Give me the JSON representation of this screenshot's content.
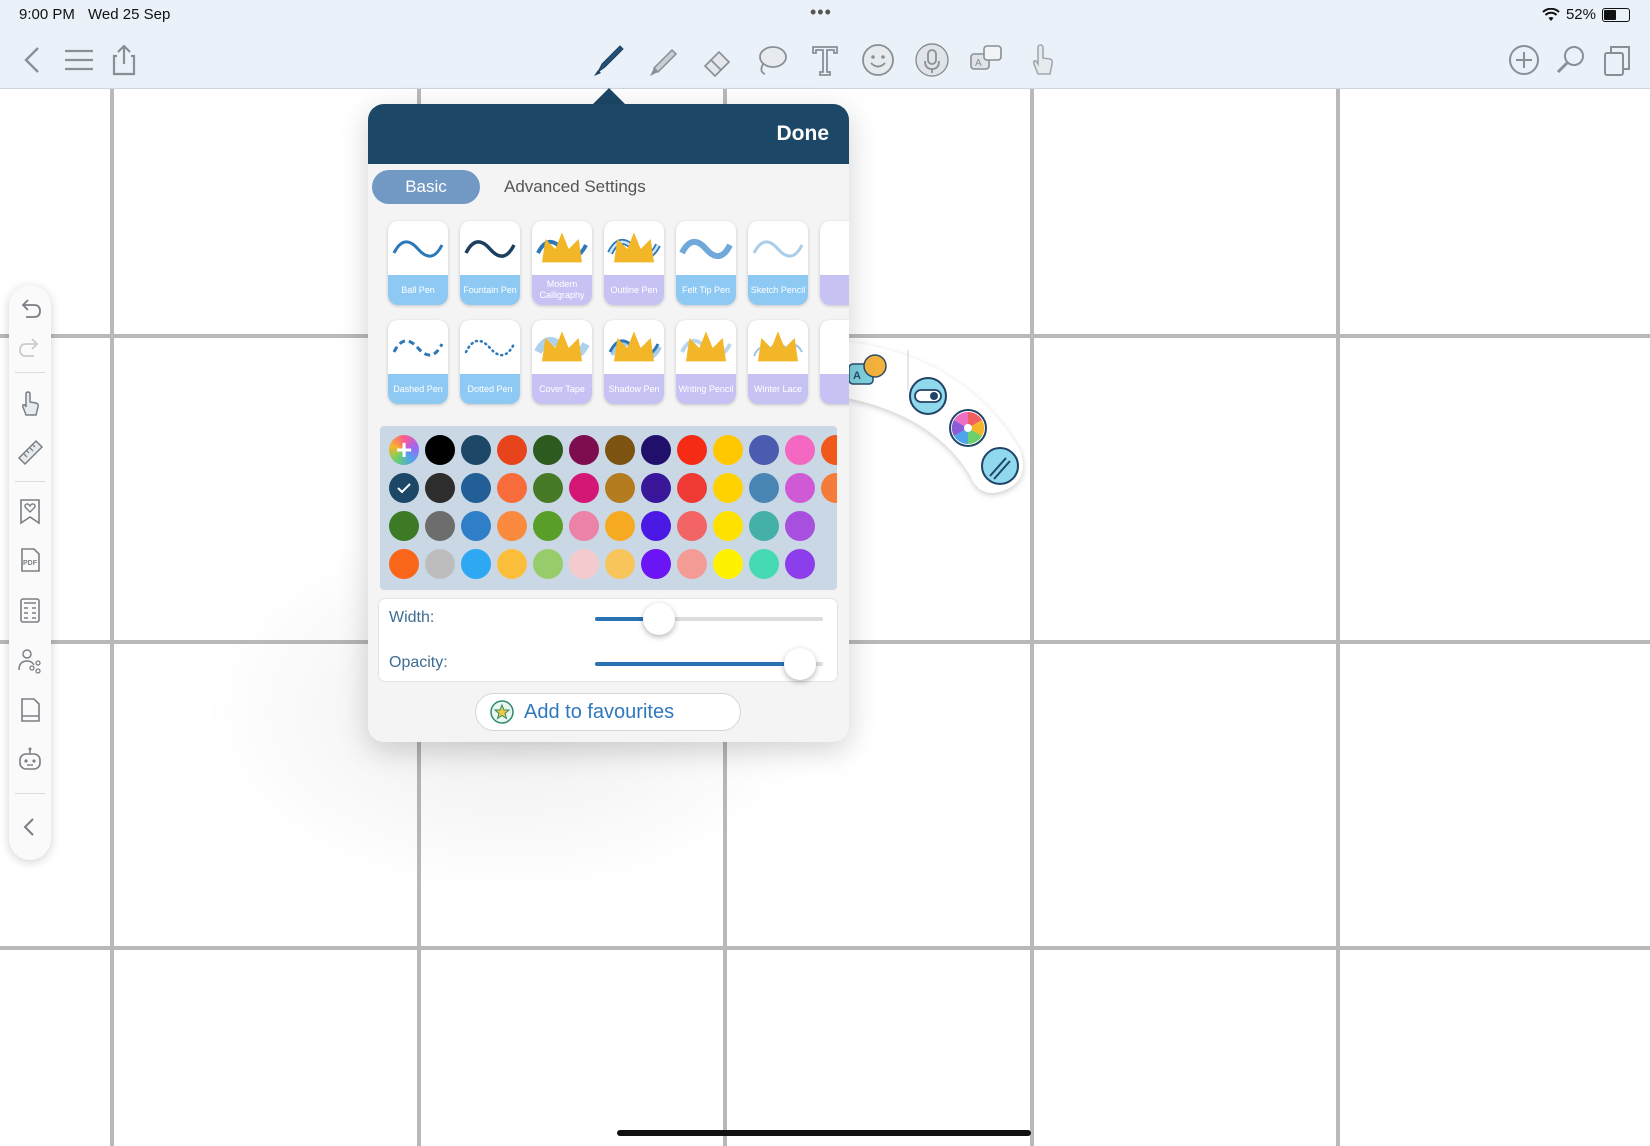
{
  "status_bar": {
    "time": "9:00 PM",
    "date": "Wed 25 Sep",
    "battery": "52%"
  },
  "toolbar": {
    "left": [
      "back-icon",
      "menu-icon",
      "share-icon"
    ],
    "center": [
      "pen-icon",
      "highlighter-icon",
      "eraser-icon",
      "lasso-icon",
      "text-icon",
      "sticker-icon",
      "microphone-icon",
      "translate-icon",
      "hand-icon"
    ],
    "right": [
      "add-page-icon",
      "search-icon",
      "pages-icon"
    ]
  },
  "popover": {
    "done_label": "Done",
    "tabs": {
      "basic": "Basic",
      "advanced": "Advanced Settings"
    },
    "pens_row1": [
      {
        "label": "Ball Pen",
        "premium": false
      },
      {
        "label": "Fountain Pen",
        "premium": false
      },
      {
        "label": "Modern Calligraphy",
        "premium": true
      },
      {
        "label": "Outline Pen",
        "premium": true
      },
      {
        "label": "Felt Tip Pen",
        "premium": false
      },
      {
        "label": "Sketch Pencil",
        "premium": false
      }
    ],
    "pens_row2": [
      {
        "label": "Dashed Pen",
        "premium": false
      },
      {
        "label": "Dotted Pen",
        "premium": false
      },
      {
        "label": "Cover Tape",
        "premium": true
      },
      {
        "label": "Shadow Pen",
        "premium": true
      },
      {
        "label": "Writing Pencil",
        "premium": true
      },
      {
        "label": "Winter Lace",
        "premium": true
      }
    ],
    "color_rows": [
      [
        "#000000",
        "#1c4766",
        "#e8441c",
        "#2d5a1f",
        "#7e0d4f",
        "#7d5312",
        "#21106b",
        "#f52b15",
        "#ffc800",
        "#4a5bb0",
        "#f468c2",
        "#f0581c"
      ],
      [
        "#2d2d2d",
        "#215f96",
        "#f96c3c",
        "#467a26",
        "#d41775",
        "#b57b1f",
        "#3a169a",
        "#ef3b33",
        "#ffd200",
        "#4a86b3",
        "#d059d6",
        "#f47b3b"
      ],
      [
        "#3c7a26",
        "#6d6d6d",
        "#2f7fc8",
        "#fa8a3e",
        "#5a9e2a",
        "#ec82a8",
        "#f5aa21",
        "#4a19e3",
        "#f36464",
        "#ffe100",
        "#44b0a8",
        "#a94fe0"
      ],
      [
        "#fa6619",
        "#bdbdbd",
        "#2ea8f2",
        "#fcbf3c",
        "#98cc6a",
        "#f3cbcf",
        "#f8c55b",
        "#6b14f5",
        "#f59b96",
        "#fff200",
        "#45dab3",
        "#8c3eed"
      ]
    ],
    "selected_color": "#1c4766",
    "width_label": "Width:",
    "width_value": 0.28,
    "opacity_label": "Opacity:",
    "opacity_value": 0.9,
    "favourites_label": "Add to favourites"
  },
  "quick_menu": [
    "translate-icon",
    "toggle-icon",
    "color-wheel-icon",
    "pen-settings-icon"
  ],
  "left_palette": [
    "undo-icon",
    "redo-icon",
    "hand-icon",
    "ruler-icon",
    "favorite-bookmark-icon",
    "pdf-icon",
    "calculator-icon",
    "share-user-icon",
    "document-icon",
    "robot-icon",
    "collapse-icon"
  ]
}
